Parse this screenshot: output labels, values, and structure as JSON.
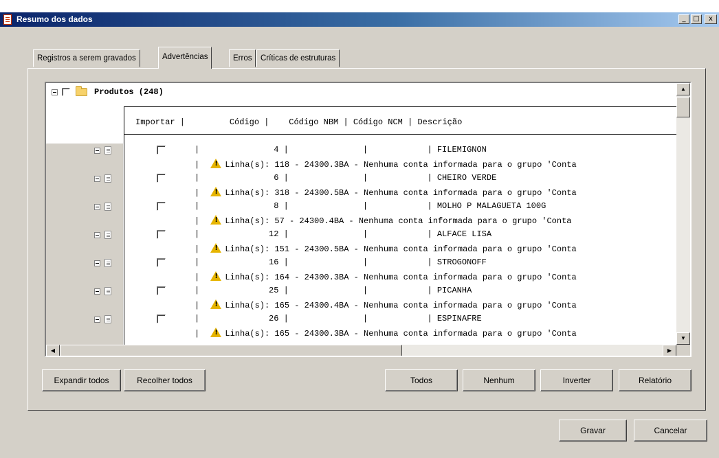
{
  "window": {
    "title": "Resumo dos dados",
    "min_label": "_",
    "max_label": "□",
    "close_label": "x"
  },
  "tabs": [
    {
      "label": "Registros a serem gravados"
    },
    {
      "label": "Advertências"
    },
    {
      "label": "Erros"
    },
    {
      "label": "Críticas de estruturas"
    }
  ],
  "tree": {
    "root_label": "Produtos (248)",
    "grid_header": "Importar |         Código |    Código NBM | Código NCM | Descrição",
    "rows": [
      {
        "line1": "|               4 |               |            | FILEMIGNON",
        "line2": "Linha(s): 118 - 24300.3BA - Nenhuma conta informada para o grupo 'Conta"
      },
      {
        "line1": "|               6 |               |            | CHEIRO VERDE",
        "line2": "Linha(s): 318 - 24300.5BA - Nenhuma conta informada para o grupo 'Conta"
      },
      {
        "line1": "|               8 |               |            | MOLHO P MALAGUETA 100G",
        "line2": "Linha(s): 57 - 24300.4BA - Nenhuma conta informada para o grupo 'Conta"
      },
      {
        "line1": "|              12 |               |            | ALFACE LISA",
        "line2": "Linha(s): 151 - 24300.5BA - Nenhuma conta informada para o grupo 'Conta"
      },
      {
        "line1": "|              16 |               |            | STROGONOFF",
        "line2": "Linha(s): 164 - 24300.3BA - Nenhuma conta informada para o grupo 'Conta"
      },
      {
        "line1": "|              25 |               |            | PICANHA",
        "line2": "Linha(s): 165 - 24300.4BA - Nenhuma conta informada para o grupo 'Conta"
      },
      {
        "line1": "|              26 |               |            | ESPINAFRE",
        "line2": "Linha(s): 165 - 24300.3BA - Nenhuma conta informada para o grupo 'Conta"
      }
    ]
  },
  "buttons": {
    "expand_all": "Expandir todos",
    "collapse_all": "Recolher todos",
    "all": "Todos",
    "none": "Nenhum",
    "invert": "Inverter",
    "report": "Relatório",
    "save": "Gravar",
    "cancel": "Cancelar"
  }
}
